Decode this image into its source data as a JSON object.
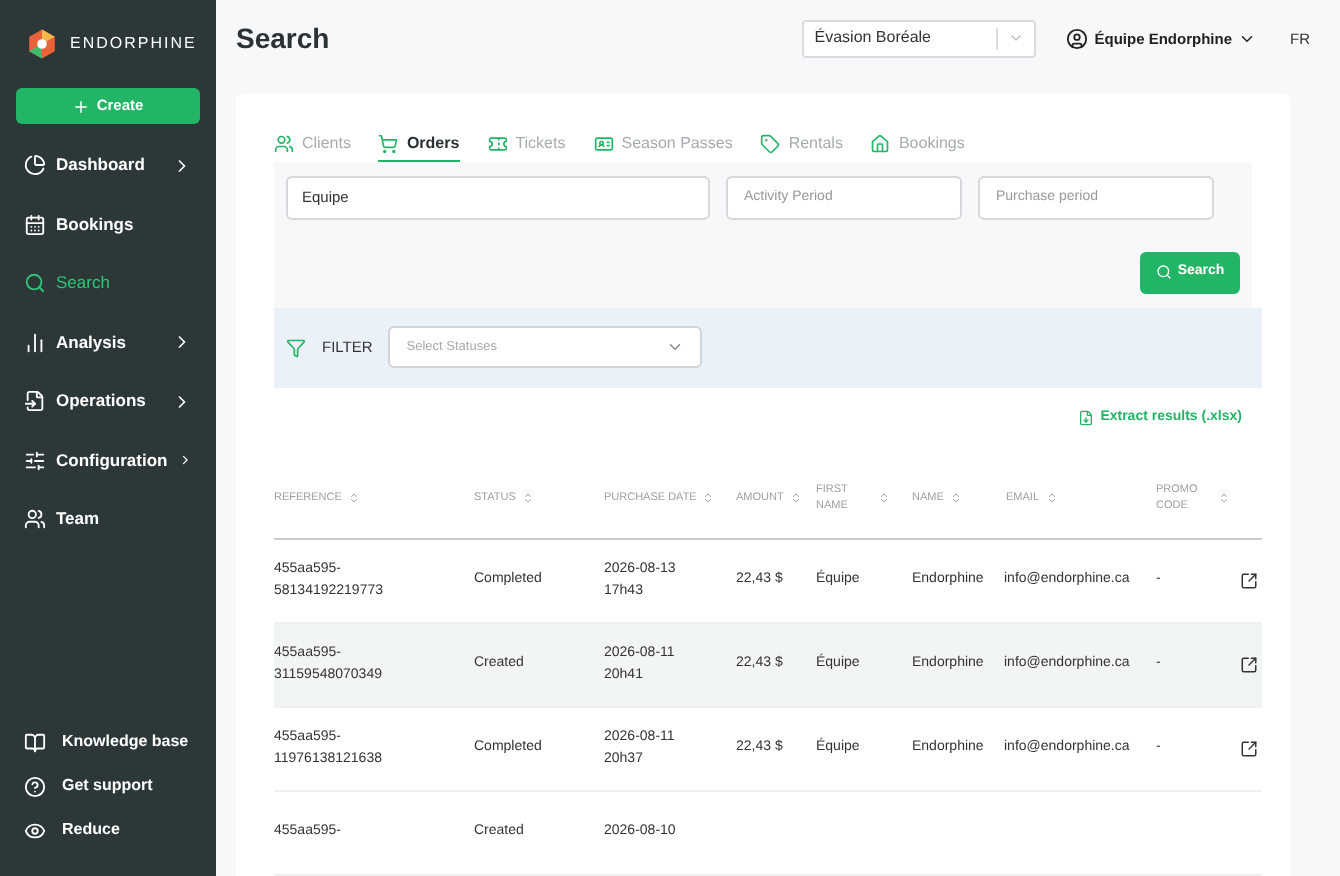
{
  "sidebar": {
    "logo_text": "ENDORPHINE",
    "create_button": "Create",
    "items": [
      {
        "label": "Dashboard",
        "expandable": true,
        "selected": false
      },
      {
        "label": "Bookings",
        "expandable": false,
        "selected": false
      },
      {
        "label": "Search",
        "expandable": false,
        "selected": true
      },
      {
        "label": "Analysis",
        "expandable": true,
        "selected": false
      },
      {
        "label": "Operations",
        "expandable": true,
        "selected": false
      },
      {
        "label": "Configuration",
        "expandable": true,
        "selected": false
      },
      {
        "label": "Team",
        "expandable": false,
        "selected": false
      }
    ],
    "footer_items": [
      {
        "label": "Knowledge base"
      },
      {
        "label": "Get support"
      },
      {
        "label": "Reduce"
      }
    ]
  },
  "header": {
    "title": "Search",
    "org_select": "Évasion Boréale",
    "user": "Équipe Endorphine",
    "language": "FR"
  },
  "tabs": [
    {
      "label": "Clients",
      "selected": false
    },
    {
      "label": "Orders",
      "selected": true
    },
    {
      "label": "Tickets",
      "selected": false
    },
    {
      "label": "Season Passes",
      "selected": false
    },
    {
      "label": "Rentals",
      "selected": false
    },
    {
      "label": "Bookings",
      "selected": false
    }
  ],
  "search_form": {
    "query": "Equipe",
    "activity_period": {
      "placeholder": "Activity Period"
    },
    "purchase_period": {
      "placeholder": "Purchase period"
    },
    "search_button": "Search"
  },
  "filter": {
    "label": "FILTER",
    "status_select": {
      "placeholder": "Select Statuses"
    }
  },
  "extract_link": "Extract results (.xlsx)",
  "table": {
    "columns": [
      "REFERENCE",
      "STATUS",
      "PURCHASE DATE",
      "AMOUNT",
      "FIRST NAME",
      "NAME",
      "EMAIL",
      "PROMO CODE"
    ],
    "rows": [
      {
        "reference": "455aa595-58134192219773",
        "status": "Completed",
        "purchase_date": "2026-08-13 17h43",
        "amount": "22,43 $",
        "first_name": "Équipe",
        "name": "Endorphine",
        "email": "info@endorphine.ca",
        "promo_code": "-",
        "selected": false
      },
      {
        "reference": "455aa595-31159548070349",
        "status": "Created",
        "purchase_date": "2026-08-11 20h41",
        "amount": "22,43 $",
        "first_name": "Équipe",
        "name": "Endorphine",
        "email": "info@endorphine.ca",
        "promo_code": "-",
        "selected": true
      },
      {
        "reference": "455aa595-11976138121638",
        "status": "Completed",
        "purchase_date": "2026-08-11 20h37",
        "amount": "22,43 $",
        "first_name": "Équipe",
        "name": "Endorphine",
        "email": "info@endorphine.ca",
        "promo_code": "-",
        "selected": false
      },
      {
        "reference": "455aa595-",
        "status": "Created",
        "purchase_date": "2026-08-10",
        "selected": false
      }
    ]
  }
}
